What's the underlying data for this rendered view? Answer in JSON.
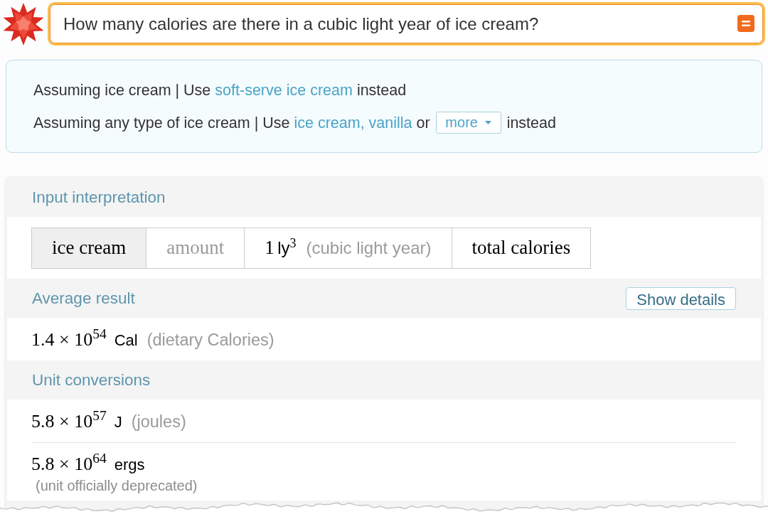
{
  "search": {
    "value": "How many calories are there in a cubic light year of ice cream?"
  },
  "assumptions": [
    {
      "segments": [
        {
          "kind": "text",
          "text": "Assuming ice cream | Use"
        },
        {
          "kind": "link",
          "text": "soft-serve ice cream"
        },
        {
          "kind": "text",
          "text": "instead"
        }
      ]
    },
    {
      "segments": [
        {
          "kind": "text",
          "text": "Assuming any type of ice cream | Use"
        },
        {
          "kind": "link",
          "text": "ice cream, vanilla"
        },
        {
          "kind": "text",
          "text": "or"
        },
        {
          "kind": "dropdown",
          "text": "more"
        },
        {
          "kind": "text",
          "text": "instead"
        }
      ]
    }
  ],
  "pods": [
    {
      "title": "Input interpretation",
      "cells": [
        {
          "kind": "header",
          "text": "ice cream"
        },
        {
          "kind": "label",
          "text": "amount"
        },
        {
          "kind": "quantity",
          "number": "1",
          "unit": "ly$^{3}$",
          "note": "(cubic light year)"
        },
        {
          "kind": "term",
          "text": "total calories"
        }
      ]
    },
    {
      "title": "Average result",
      "button": "Show details",
      "results": [
        {
          "kind": "inline",
          "value": "1.4 × 10$^{54}$",
          "unit": "Cal",
          "note": "(dietary Calories)"
        }
      ]
    },
    {
      "title": "Unit conversions",
      "results": [
        {
          "kind": "inline",
          "value": "5.8 × 10$^{57}$",
          "unit": "J",
          "note": "(joules)"
        },
        {
          "kind": "stacked",
          "value": "5.8 × 10$^{64}$",
          "unit": "ergs",
          "note": "(unit officially deprecated)"
        }
      ]
    }
  ]
}
